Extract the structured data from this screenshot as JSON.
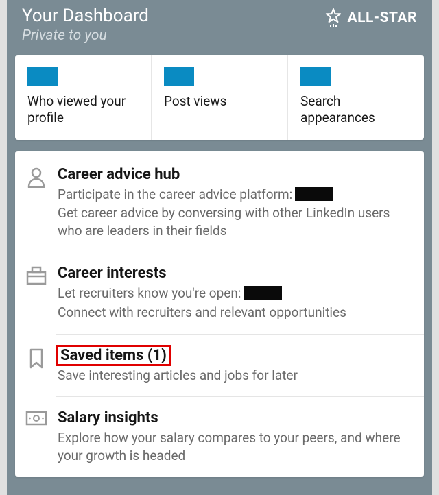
{
  "header": {
    "title": "Your Dashboard",
    "subtitle": "Private to you",
    "badge_label": "ALL-STAR"
  },
  "stats": [
    {
      "label": "Who viewed your profile"
    },
    {
      "label": "Post views"
    },
    {
      "label": "Search appearances"
    }
  ],
  "items": [
    {
      "title": "Career advice hub",
      "subtitle_prefix": "Participate in the career advice platform:",
      "has_redact": true,
      "desc": "Get career advice by conversing with other LinkedIn users who are leaders in their fields",
      "highlight": false
    },
    {
      "title": "Career interests",
      "subtitle_prefix": "Let recruiters know you're open:",
      "has_redact": true,
      "desc": "Connect with recruiters and relevant opportunities",
      "highlight": false
    },
    {
      "title": "Saved items (1)",
      "subtitle_prefix": "Save interesting articles and jobs for later",
      "has_redact": false,
      "desc": "",
      "highlight": true
    },
    {
      "title": "Salary insights",
      "subtitle_prefix": "Explore how your salary compares to your peers, and where your growth is headed",
      "has_redact": false,
      "desc": "",
      "highlight": false
    }
  ]
}
